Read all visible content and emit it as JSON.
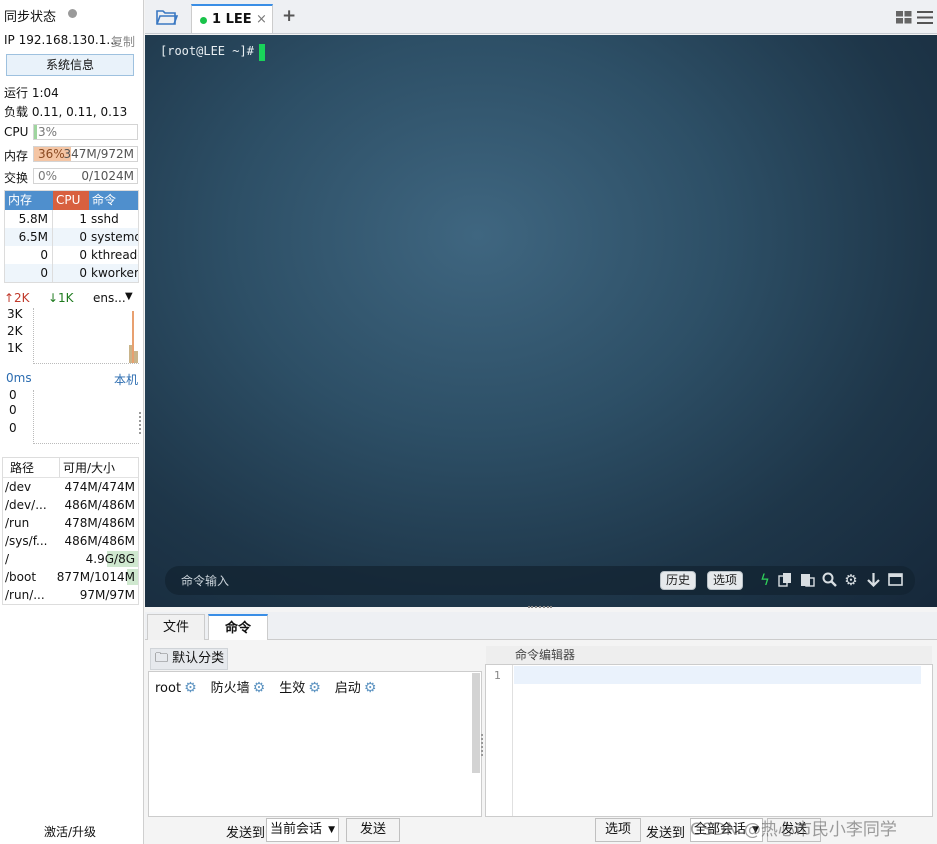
{
  "left": {
    "sync_status": "同步状态",
    "ip": "IP 192.168.130.1...",
    "copy": "复制",
    "sysinfo_btn": "系统信息",
    "uptime": "运行 1:04",
    "load": "负载 0.11, 0.11, 0.13",
    "cpu": {
      "label": "CPU",
      "value": "3%",
      "pct": 3
    },
    "mem": {
      "label": "内存",
      "pct_text": "36%",
      "value": "347M/972M",
      "pct": 36
    },
    "swap": {
      "label": "交换",
      "pct_text": "0%",
      "value": "0/1024M",
      "pct": 0
    },
    "proc_headers": [
      "内存",
      "CPU",
      "命令"
    ],
    "processes": [
      {
        "mem": "5.8M",
        "cpu": "1",
        "cmd": "sshd"
      },
      {
        "mem": "6.5M",
        "cpu": "0",
        "cmd": "systemd"
      },
      {
        "mem": "0",
        "cpu": "0",
        "cmd": "kthreadd"
      },
      {
        "mem": "0",
        "cpu": "0",
        "cmd": "kworker"
      }
    ],
    "net": {
      "up": "2K",
      "down": "1K",
      "iface": "ens...",
      "ticks": [
        "3K",
        "2K",
        "1K"
      ]
    },
    "latency": {
      "ms": "0ms",
      "host": "本机",
      "vals": [
        "0",
        "0",
        "0"
      ]
    },
    "disk_headers": [
      "路径",
      "可用/大小"
    ],
    "disks": [
      {
        "path": "/dev",
        "size": "474M/474M",
        "used_pct": 0
      },
      {
        "path": "/dev/...",
        "size": "486M/486M",
        "used_pct": 0
      },
      {
        "path": "/run",
        "size": "478M/486M",
        "used_pct": 2
      },
      {
        "path": "/sys/f...",
        "size": "486M/486M",
        "used_pct": 0
      },
      {
        "path": "/",
        "size": "4.9G/8G",
        "used_pct": 39
      },
      {
        "path": "/boot",
        "size": "877M/1014M",
        "used_pct": 14
      },
      {
        "path": "/run/...",
        "size": "97M/97M",
        "used_pct": 0
      }
    ],
    "activate": "激活/升级"
  },
  "tabs": {
    "session": "1 LEE",
    "close": "×",
    "add": "+"
  },
  "terminal": {
    "prompt": "[root@LEE ~]#",
    "cmd_placeholder": "命令输入",
    "history_btn": "历史",
    "options_btn": "选项"
  },
  "bottom": {
    "tabs": [
      "文件",
      "命令"
    ],
    "category": "默认分类",
    "commands": [
      "root",
      "防火墙",
      "生效",
      "启动"
    ],
    "editor_title": "命令编辑器",
    "line_no": "1",
    "send_to": "发送到",
    "current_session": "当前会话",
    "send": "发送",
    "options": "选项",
    "all_sessions": "全部会话"
  },
  "watermark": "CSDN @热心市民小李同学",
  "colors": {
    "accent": "#3a8ee6",
    "cursor": "#19d35a",
    "mem_header": "#4f8fcd",
    "cpu_header": "#d8603f"
  }
}
